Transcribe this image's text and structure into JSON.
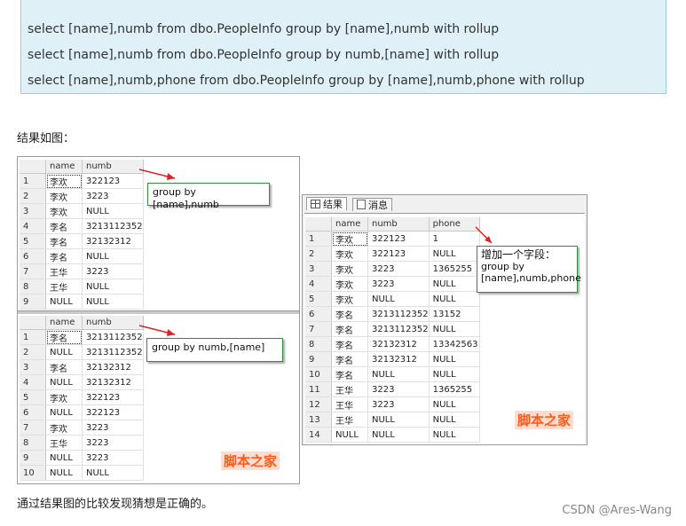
{
  "code": {
    "lines": [
      "select [name],numb from dbo.PeopleInfo group by [name],numb with rollup",
      "select [name],numb from dbo.PeopleInfo group by numb,[name] with rollup",
      "select [name],numb,phone from dbo.PeopleInfo group by [name],numb,phone with rollup"
    ]
  },
  "caption_top": "结果如图：",
  "caption_bottom": "通过结果图的比较发现猜想是正确的。",
  "credit": "CSDN @Ares-Wang",
  "grid1": {
    "headers": [
      "name",
      "numb"
    ],
    "rows": [
      [
        "1",
        "李欢",
        "322123"
      ],
      [
        "2",
        "李欢",
        "3223"
      ],
      [
        "3",
        "李欢",
        "NULL"
      ],
      [
        "4",
        "李名",
        "3213112352"
      ],
      [
        "5",
        "李名",
        "32132312"
      ],
      [
        "6",
        "李名",
        "NULL"
      ],
      [
        "7",
        "王华",
        "3223"
      ],
      [
        "8",
        "王华",
        "NULL"
      ],
      [
        "9",
        "NULL",
        "NULL"
      ]
    ],
    "note": "group by [name],numb"
  },
  "grid2": {
    "headers": [
      "name",
      "numb"
    ],
    "rows": [
      [
        "1",
        "李名",
        "3213112352"
      ],
      [
        "2",
        "NULL",
        "3213112352"
      ],
      [
        "3",
        "李名",
        "32132312"
      ],
      [
        "4",
        "NULL",
        "32132312"
      ],
      [
        "5",
        "李欢",
        "322123"
      ],
      [
        "6",
        "NULL",
        "322123"
      ],
      [
        "7",
        "李欢",
        "3223"
      ],
      [
        "8",
        "王华",
        "3223"
      ],
      [
        "9",
        "NULL",
        "3223"
      ],
      [
        "10",
        "NULL",
        "NULL"
      ]
    ],
    "note": "group by numb,[name]",
    "watermark": "脚本之家"
  },
  "grid3": {
    "tabs": [
      "结果",
      "消息"
    ],
    "headers": [
      "name",
      "numb",
      "phone"
    ],
    "rows": [
      [
        "1",
        "李欢",
        "322123",
        "1"
      ],
      [
        "2",
        "李欢",
        "322123",
        "NULL"
      ],
      [
        "3",
        "李欢",
        "3223",
        "1365255"
      ],
      [
        "4",
        "李欢",
        "3223",
        "NULL"
      ],
      [
        "5",
        "李欢",
        "NULL",
        "NULL"
      ],
      [
        "6",
        "李名",
        "3213112352",
        "13152"
      ],
      [
        "7",
        "李名",
        "3213112352",
        "NULL"
      ],
      [
        "8",
        "李名",
        "32132312",
        "13342563"
      ],
      [
        "9",
        "李名",
        "32132312",
        "NULL"
      ],
      [
        "10",
        "李名",
        "NULL",
        "NULL"
      ],
      [
        "11",
        "王华",
        "3223",
        "1365255"
      ],
      [
        "12",
        "王华",
        "3223",
        "NULL"
      ],
      [
        "13",
        "王华",
        "NULL",
        "NULL"
      ],
      [
        "14",
        "NULL",
        "NULL",
        "NULL"
      ]
    ],
    "note_title": "增加一个字段：",
    "note_body": "group by [name],numb,phone",
    "watermark": "脚本之家"
  }
}
